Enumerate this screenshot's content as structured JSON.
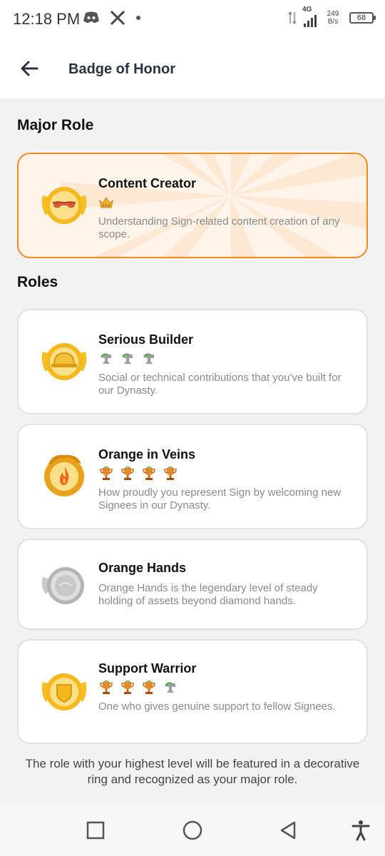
{
  "status_bar": {
    "time": "12:18 PM",
    "left_icons": [
      "discord-icon",
      "x-icon",
      "dot-icon"
    ],
    "network_type": "4G",
    "speed_value": "249",
    "speed_unit": "B/s",
    "battery": "68"
  },
  "app_bar": {
    "back_icon": "arrow-left-icon",
    "title": "Badge of Honor"
  },
  "major_role": {
    "section_title": "Major Role",
    "card": {
      "title": "Content Creator",
      "levels": [
        "crown-icon"
      ],
      "description": "Understanding Sign-related content creation of any scope.",
      "badge_icon": "sunglasses-badge-icon"
    }
  },
  "roles": {
    "section_title": "Roles",
    "items": [
      {
        "title": "Serious Builder",
        "levels": [
          "anvil-icon",
          "anvil-icon",
          "anvil-icon"
        ],
        "description": "Social or technical contributions that you've built for our Dynasty.",
        "badge_icon": "hardhat-badge-icon"
      },
      {
        "title": "Orange in Veins",
        "levels": [
          "trophy-icon",
          "trophy-icon",
          "trophy-icon",
          "trophy-icon"
        ],
        "description": "How proudly you represent Sign by welcoming new Signees in our Dynasty.",
        "badge_icon": "dragon-flame-badge-icon"
      },
      {
        "title": "Orange Hands",
        "levels": [],
        "description": "Orange Hands is the legendary level of steady holding of assets beyond diamond hands.",
        "badge_icon": "silver-coin-badge-icon"
      },
      {
        "title": "Support Warrior",
        "levels": [
          "trophy-icon",
          "trophy-icon",
          "trophy-icon",
          "anvil-icon"
        ],
        "description": "One who gives genuine support to fellow Signees.",
        "badge_icon": "shield-badge-icon"
      }
    ]
  },
  "footer_note": "The role with your highest level will be featured in a decorative ring and recognized as your major role.",
  "nav_bar": {
    "items": [
      "recents-square-icon",
      "home-circle-icon",
      "back-triangle-icon",
      "accessibility-icon"
    ]
  },
  "colors": {
    "accent": "#ef8a1c",
    "major_card_bg": "#fff4ea",
    "badge_gold": "#f6b81c",
    "text_muted": "#8a8a8a"
  }
}
